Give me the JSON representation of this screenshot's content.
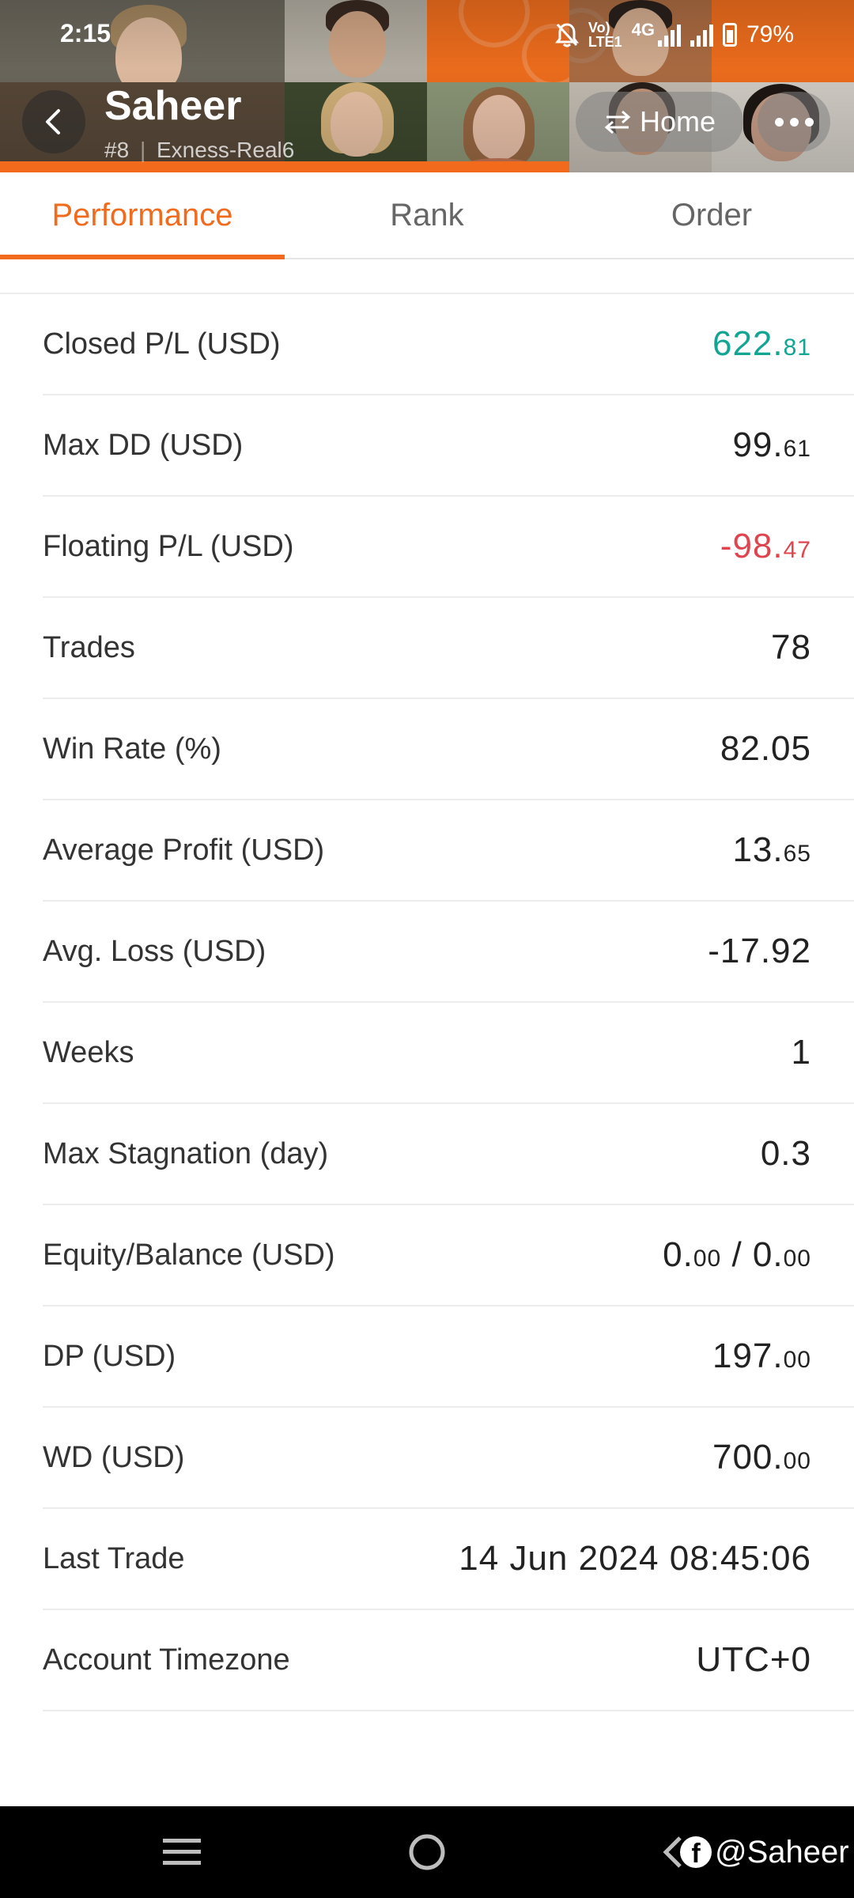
{
  "status_bar": {
    "time": "2:15",
    "network_volte": "Vo)",
    "network_lte": "LTE1",
    "network_type": "4G",
    "battery": "79%"
  },
  "header": {
    "name": "Saheer",
    "rank": "#8",
    "account": "Exness-Real6",
    "home_label": "Home",
    "accent_color": "#f26a1b"
  },
  "tabs": [
    {
      "label": "Performance",
      "active": true
    },
    {
      "label": "Rank",
      "active": false
    },
    {
      "label": "Order",
      "active": false
    }
  ],
  "stats": [
    {
      "label": "Closed P/L (USD)",
      "int": "622.",
      "dec": "81",
      "color": "#12a594"
    },
    {
      "label": "Max DD (USD)",
      "int": "99.",
      "dec": "61"
    },
    {
      "label": "Floating P/L (USD)",
      "int": "-98.",
      "dec": "47",
      "color": "#e0454f"
    },
    {
      "label": "Trades",
      "value": "78"
    },
    {
      "label": "Win Rate (%)",
      "value": "82.05"
    },
    {
      "label": "Average Profit (USD)",
      "int": "13.",
      "dec": "65"
    },
    {
      "label": "Avg. Loss (USD)",
      "value": "-17.92"
    },
    {
      "label": "Weeks",
      "value": "1"
    },
    {
      "label": "Max Stagnation (day)",
      "value": "0.3"
    },
    {
      "label": "Equity/Balance (USD)",
      "eq_int": "0.",
      "eq_dec": "00",
      "sep": " / ",
      "bal_int": "0.",
      "bal_dec": "00"
    },
    {
      "label": "DP (USD)",
      "int": "197.",
      "dec": "00"
    },
    {
      "label": "WD (USD)",
      "int": "700.",
      "dec": "00"
    },
    {
      "label": "Last Trade",
      "value": "14 Jun 2024 08:45:06"
    },
    {
      "label": "Account Timezone",
      "value": "UTC+0"
    }
  ],
  "watermark": {
    "fb_letter": "f",
    "handle": "@Saheer"
  }
}
